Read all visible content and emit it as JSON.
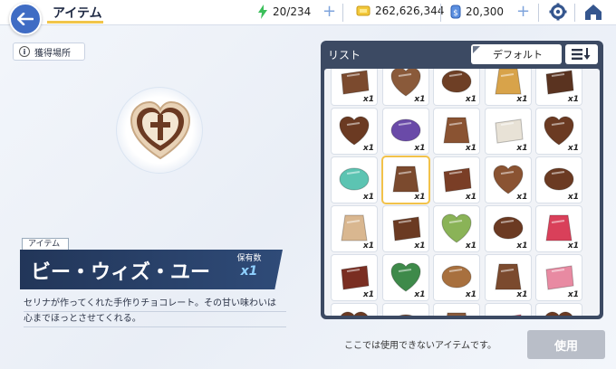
{
  "header": {
    "title": "アイテム",
    "stamina": "20/234",
    "gold": "262,626,344",
    "gems": "20,300"
  },
  "detail": {
    "source_label": "獲得場所",
    "category": "アイテム",
    "item_name": "ビー・ウィズ・ユー",
    "owned_label": "保有数",
    "owned_value": "x1",
    "description_lines": [
      "セリナが作ってくれた手作りチョコレート。その甘い味わいは",
      "心までほっとさせてくれる。"
    ]
  },
  "list": {
    "title": "リスト",
    "sort_label": "デフォルト",
    "items": [
      {
        "icon": "chocolate-bowl-icon",
        "qty": "x1",
        "color": "#7b4a2e"
      },
      {
        "icon": "chocolate-cake-icon",
        "qty": "x1",
        "color": "#8a5a3a"
      },
      {
        "icon": "chocolate-tart-icon",
        "qty": "x1",
        "color": "#6e3f25"
      },
      {
        "icon": "chocolate-plate-icon",
        "qty": "x1",
        "color": "#d8a34a"
      },
      {
        "icon": "chocolate-truffles-icon",
        "qty": "x1",
        "color": "#5a3320"
      },
      {
        "icon": "chocolate-bar-icon",
        "qty": "x1",
        "color": "#6b3a22"
      },
      {
        "icon": "chocolate-box-icon",
        "qty": "x1",
        "color": "#6a4aa8"
      },
      {
        "icon": "chocolate-stick-icon",
        "qty": "x1",
        "color": "#8a5332"
      },
      {
        "icon": "chocolate-roll-icon",
        "qty": "x1",
        "color": "#e8e2d6"
      },
      {
        "icon": "chocolate-bunny-icon",
        "qty": "x1",
        "color": "#6b3a22"
      },
      {
        "icon": "mint-chocolate-icon",
        "qty": "x1",
        "color": "#5cc4b2"
      },
      {
        "icon": "heart-chocolate-icon",
        "qty": "x1",
        "color": "#7b4a2e"
      },
      {
        "icon": "chocolate-book-icon",
        "qty": "x1",
        "color": "#7a3e26"
      },
      {
        "icon": "chocolate-cone-icon",
        "qty": "x1",
        "color": "#8a5332"
      },
      {
        "icon": "star-chocolate-icon",
        "qty": "x1",
        "color": "#6b3a22"
      },
      {
        "icon": "chocolate-tile-icon",
        "qty": "x1",
        "color": "#d9b790"
      },
      {
        "icon": "chocolate-mascot-icon",
        "qty": "x1",
        "color": "#6b3a22"
      },
      {
        "icon": "green-tea-chocolate-icon",
        "qty": "x1",
        "color": "#8ab357"
      },
      {
        "icon": "chocolate-square-icon",
        "qty": "x1",
        "color": "#6b3a22"
      },
      {
        "icon": "pink-gift-box-icon",
        "qty": "x1",
        "color": "#d9405a"
      },
      {
        "icon": "chocolate-assortment-icon",
        "qty": "x1",
        "color": "#7a2e22"
      },
      {
        "icon": "chocolate-selection-icon",
        "qty": "x1",
        "color": "#3e8a4a"
      },
      {
        "icon": "chocolate-cookies-icon",
        "qty": "x1",
        "color": "#a8703e"
      },
      {
        "icon": "heart-ribbon-chocolate-icon",
        "qty": "x1",
        "color": "#7b4a2e"
      },
      {
        "icon": "pink-heart-box-icon",
        "qty": "x1",
        "color": "#e88aa2"
      },
      {
        "icon": "partial-item-icon",
        "qty": "",
        "color": "#6b3a22"
      },
      {
        "icon": "partial-item-icon",
        "qty": "",
        "color": "#7b4a2e"
      },
      {
        "icon": "partial-item-icon",
        "qty": "",
        "color": "#8a5a3a"
      },
      {
        "icon": "partial-item-icon",
        "qty": "",
        "color": "#d9405a"
      },
      {
        "icon": "partial-item-icon",
        "qty": "",
        "color": "#6b3a22"
      }
    ]
  },
  "footer": {
    "unusable_text": "ここでは使用できないアイテムです。",
    "use_button": "使用"
  }
}
